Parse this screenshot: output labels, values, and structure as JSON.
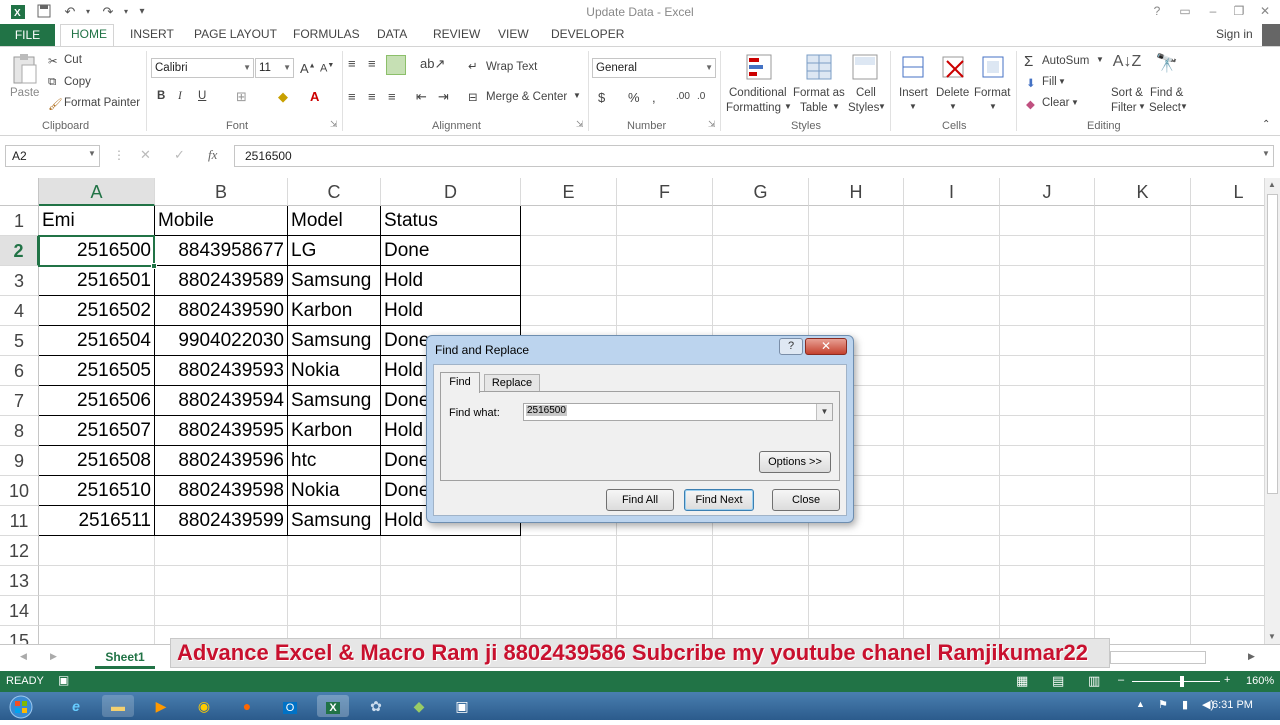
{
  "window": {
    "title": "Update Data - Excel",
    "controls": [
      "?",
      "▭",
      "–",
      "❐",
      "✕"
    ]
  },
  "ribbon_tabs": [
    "FILE",
    "HOME",
    "INSERT",
    "PAGE LAYOUT",
    "FORMULAS",
    "DATA",
    "REVIEW",
    "VIEW",
    "DEVELOPER"
  ],
  "signin": "Sign in",
  "clipboard": {
    "paste": "Paste",
    "cut": "Cut",
    "copy": "Copy",
    "format_painter": "Format Painter",
    "label": "Clipboard"
  },
  "font": {
    "name": "Calibri",
    "size": "11",
    "label": "Font"
  },
  "alignment": {
    "wrap": "Wrap Text",
    "merge": "Merge & Center",
    "label": "Alignment"
  },
  "number": {
    "format": "General",
    "label": "Number"
  },
  "styles": {
    "cond1": "Conditional",
    "cond2": "Formatting",
    "fmt1": "Format as",
    "fmt2": "Table",
    "cell1": "Cell",
    "cell2": "Styles",
    "label": "Styles"
  },
  "cells": {
    "insert": "Insert",
    "delete": "Delete",
    "format": "Format",
    "label": "Cells"
  },
  "editing": {
    "autosum": "AutoSum",
    "fill": "Fill",
    "clear": "Clear",
    "sort1": "Sort &",
    "sort2": "Filter",
    "find1": "Find &",
    "find2": "Select",
    "label": "Editing"
  },
  "formula_bar": {
    "name_box": "A2",
    "fx": "fx",
    "value": "2516500"
  },
  "columns": [
    "A",
    "B",
    "C",
    "D",
    "E",
    "F",
    "G",
    "H",
    "I",
    "J",
    "K",
    "L"
  ],
  "rows": [
    "1",
    "2",
    "3",
    "4",
    "5",
    "6",
    "7",
    "8",
    "9",
    "10",
    "11",
    "12",
    "13",
    "14",
    "15"
  ],
  "table": {
    "headers": [
      "Emi",
      "Mobile",
      "Model",
      "Status"
    ],
    "rows": [
      [
        "2516500",
        "8843958677",
        "LG",
        "Done"
      ],
      [
        "2516501",
        "8802439589",
        "Samsung",
        "Hold"
      ],
      [
        "2516502",
        "8802439590",
        "Karbon",
        "Hold"
      ],
      [
        "2516504",
        "9904022030",
        "Samsung",
        "Done"
      ],
      [
        "2516505",
        "8802439593",
        "Nokia",
        "Hold"
      ],
      [
        "2516506",
        "8802439594",
        "Samsung",
        "Done"
      ],
      [
        "2516507",
        "8802439595",
        "Karbon",
        "Hold"
      ],
      [
        "2516508",
        "8802439596",
        "htc",
        "Done"
      ],
      [
        "2516510",
        "8802439598",
        "Nokia",
        "Done"
      ],
      [
        "2516511",
        "8802439599",
        "Samsung",
        "Hold"
      ]
    ]
  },
  "sheet_tab": "Sheet1",
  "banner": "Advance Excel & Macro Ram ji 8802439586 Subcribe my youtube chanel Ramjikumar22",
  "status": {
    "ready": "READY",
    "zoom": "160%"
  },
  "clock": "6:31 PM",
  "dialog": {
    "title": "Find and Replace",
    "help": "?",
    "close_x": "✕",
    "tab_find": "Find",
    "tab_replace": "Replace",
    "find_what_label": "Find what:",
    "find_what_value": "2516500",
    "options": "Options >>",
    "find_all": "Find All",
    "find_next": "Find Next",
    "close": "Close"
  },
  "colors": {
    "accent": "#217346",
    "banner_text": "#c8102e"
  }
}
